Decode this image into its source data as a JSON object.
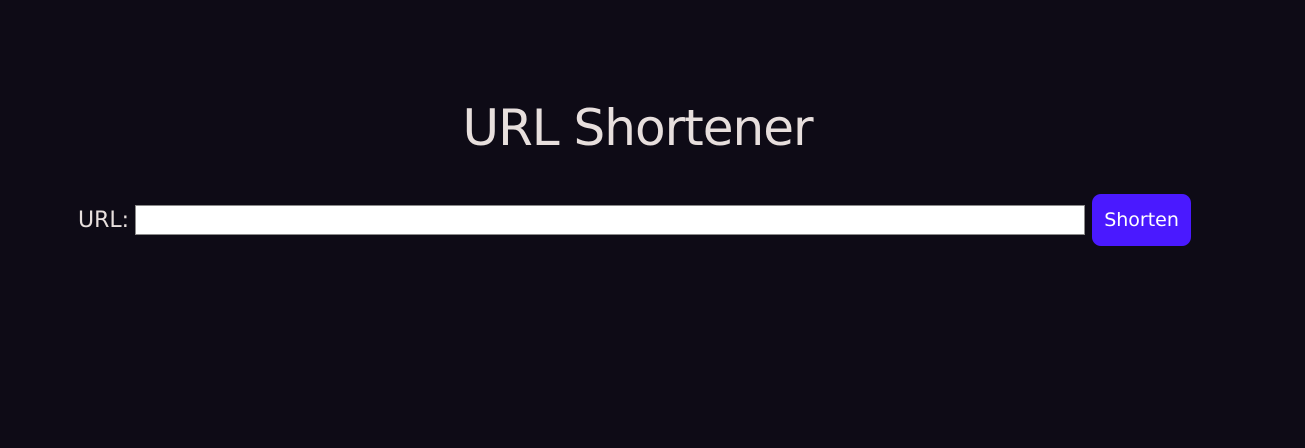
{
  "page": {
    "title": "URL Shortener"
  },
  "form": {
    "url_label": "URL:",
    "url_value": "",
    "url_placeholder": "",
    "submit_label": "Shorten"
  },
  "colors": {
    "background": "#0e0b16",
    "text": "#e7dfdd",
    "accent": "#4a19ff"
  }
}
